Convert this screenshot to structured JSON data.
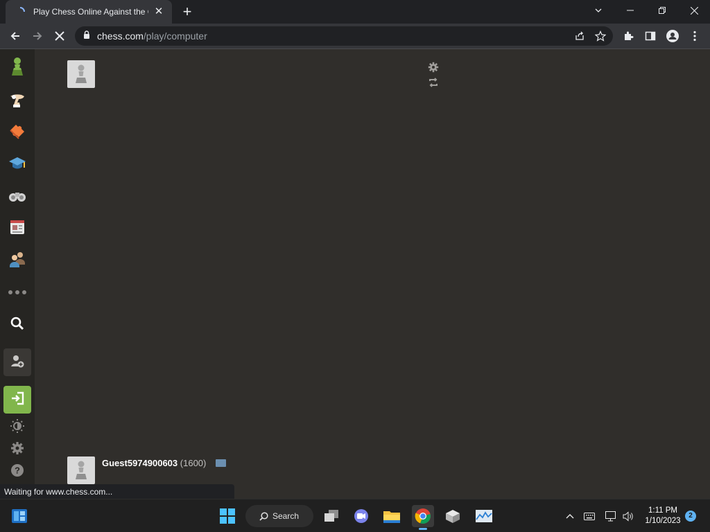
{
  "browser": {
    "tab_title": "Play Chess Online Against the Computer",
    "url_host": "chess.com",
    "url_path": "/play/computer",
    "status_text": "Waiting for www.chess.com..."
  },
  "sidebar": {
    "items": [
      {
        "icon": "pawn-logo-icon",
        "label": "Home"
      },
      {
        "icon": "play-hand-icon",
        "label": "Play"
      },
      {
        "icon": "puzzle-icon",
        "label": "Puzzles"
      },
      {
        "icon": "learn-cap-icon",
        "label": "Learn"
      },
      {
        "icon": "watch-binoculars-icon",
        "label": "Watch"
      },
      {
        "icon": "news-icon",
        "label": "News"
      },
      {
        "icon": "social-icon",
        "label": "Social"
      },
      {
        "icon": "more-icon",
        "label": "More"
      },
      {
        "icon": "search-icon",
        "label": "Search"
      },
      {
        "icon": "sign-up-icon",
        "label": "Sign Up"
      },
      {
        "icon": "log-in-icon",
        "label": "Log In"
      },
      {
        "icon": "theme-icon",
        "label": "Theme"
      },
      {
        "icon": "settings-icon",
        "label": "Settings"
      },
      {
        "icon": "help-icon",
        "label": "Help"
      }
    ]
  },
  "player": {
    "name": "Guest5974900603",
    "rating": "(1600)"
  },
  "taskbar": {
    "search_label": "Search",
    "time": "1:11 PM",
    "date": "1/10/2023",
    "notification_count": "2"
  },
  "colors": {
    "background": "#302e2b",
    "sidebar": "#262522",
    "accent_green": "#81b64c",
    "taskbar": "#202020"
  }
}
